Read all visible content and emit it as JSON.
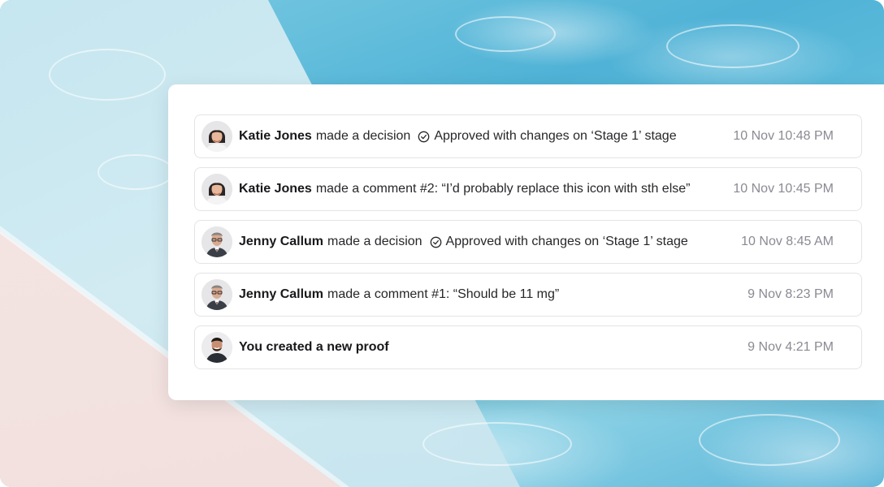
{
  "activity": {
    "items": [
      {
        "name": "Katie Jones",
        "action": "made a decision",
        "decision": "Approved with changes on ‘Stage 1’ stage",
        "comment": "",
        "time": "10 Nov 10:48 PM",
        "avatar_icon": "woman-avatar-icon"
      },
      {
        "name": "Katie Jones",
        "action": "made a comment #2: “I’d probably replace this icon with sth else”",
        "decision": "",
        "time": "10 Nov 10:45 PM",
        "avatar_icon": "woman-avatar-icon"
      },
      {
        "name": "Jenny Callum",
        "action": "made a decision",
        "decision": "Approved with changes on ‘Stage 1’ stage",
        "time": "10 Nov 8:45 AM",
        "avatar_icon": "man-glasses-avatar-icon"
      },
      {
        "name": "Jenny Callum",
        "action": "made a comment #1: “Should be 11 mg”",
        "decision": "",
        "time": "9 Nov 8:23 PM",
        "avatar_icon": "man-glasses-avatar-icon"
      },
      {
        "name": "You created a new proof",
        "action": "",
        "decision": "",
        "time": "9 Nov 4:21 PM",
        "avatar_icon": "man-beard-avatar-icon"
      }
    ]
  },
  "colors": {
    "border": "#e4e4e7",
    "text": "#27272a",
    "timestamp": "#8a8a93",
    "water": "#4fb2d6",
    "deck": "#f2e2e0"
  }
}
